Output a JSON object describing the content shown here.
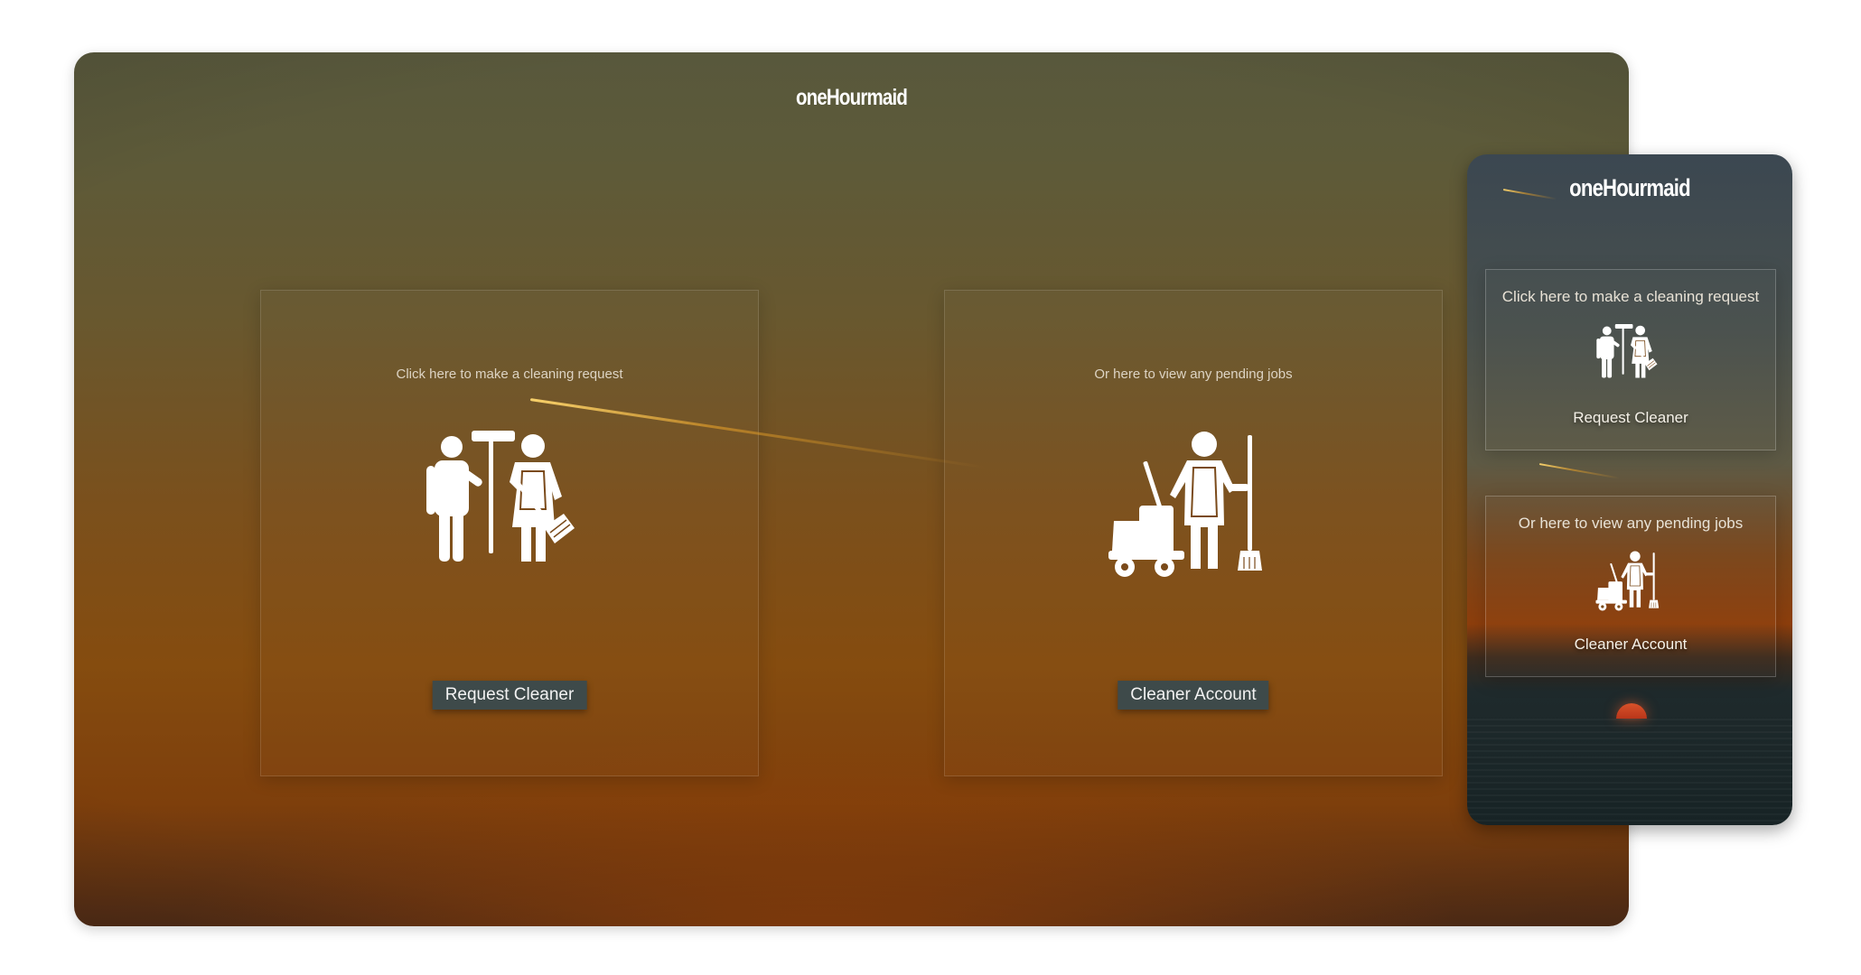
{
  "brand": {
    "name": "oneHourmaid"
  },
  "desktop": {
    "request_card": {
      "caption": "Click here to make a cleaning request",
      "icon": "cleaners-with-tools-icon",
      "button_label": "Request Cleaner"
    },
    "cleaner_card": {
      "caption": "Or here to view any pending jobs",
      "icon": "janitor-with-cart-icon",
      "button_label": "Cleaner Account"
    }
  },
  "mobile": {
    "request_card": {
      "caption": "Click here to make a cleaning request",
      "icon": "cleaners-with-tools-icon",
      "link_label": "Request Cleaner"
    },
    "cleaner_card": {
      "caption": "Or here to view any pending jobs",
      "icon": "janitor-with-cart-icon",
      "link_label": "Cleaner Account"
    }
  },
  "colors": {
    "button_bg": "#3e4a4a",
    "icon": "#ffffff",
    "caption_text": "#ddd4c4"
  }
}
